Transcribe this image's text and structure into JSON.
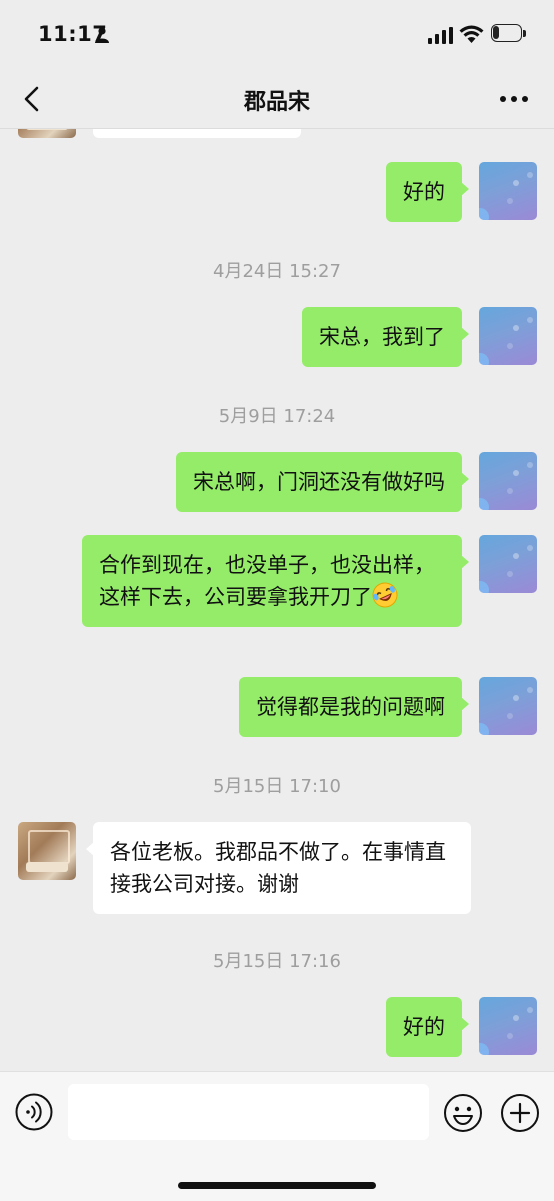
{
  "status_bar": {
    "time": "11:17",
    "battery": "23",
    "battery_level": 0.23
  },
  "header": {
    "title": "郡品宋"
  },
  "messages": [
    {
      "type": "text",
      "from": "me",
      "text": "好的"
    },
    {
      "type": "time",
      "text": "4月24日 15:27"
    },
    {
      "type": "text",
      "from": "me",
      "text": "宋总，我到了"
    },
    {
      "type": "time",
      "text": "5月9日 17:24"
    },
    {
      "type": "text",
      "from": "me",
      "text": "宋总啊，门洞还没有做好吗"
    },
    {
      "type": "text",
      "from": "me",
      "text": "合作到现在，也没单子，也没出样，这样下去，公司要拿我开刀了",
      "emoji": "rofl-emoji"
    },
    {
      "type": "text",
      "from": "me",
      "text": "觉得都是我的问题啊"
    },
    {
      "type": "time",
      "text": "5月15日 17:10"
    },
    {
      "type": "text",
      "from": "other",
      "text": "各位老板。我郡品不做了。在事情直接我公司对接。谢谢"
    },
    {
      "type": "time",
      "text": "5月15日 17:16"
    },
    {
      "type": "text",
      "from": "me",
      "text": "好的"
    }
  ],
  "input_bar": {
    "text_value": "",
    "icons": [
      "voice-icon",
      "emoji-icon",
      "plus-icon"
    ]
  },
  "colors": {
    "my_bubble": "#95ec69",
    "their_bubble": "#ffffff",
    "background": "#ededed",
    "timestamp": "#9e9e9e"
  }
}
